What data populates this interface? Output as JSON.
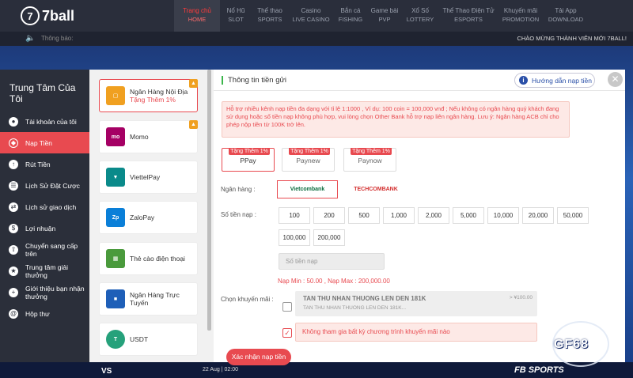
{
  "nav": {
    "logo_text": "7ball",
    "items": [
      {
        "label": "Trang chủ",
        "sub": "HOME",
        "active": true
      },
      {
        "label": "Nổ Hũ",
        "sub": "SLOT"
      },
      {
        "label": "Thể thao",
        "sub": "SPORTS"
      },
      {
        "label": "Casino",
        "sub": "LIVE CASINO"
      },
      {
        "label": "Bắn cá",
        "sub": "FISHING"
      },
      {
        "label": "Game bài",
        "sub": "PVP"
      },
      {
        "label": "Xổ Số",
        "sub": "LOTTERY"
      },
      {
        "label": "Thể Thao Điện Tử",
        "sub": "ESPORTS"
      },
      {
        "label": "Khuyến mãi",
        "sub": "PROMOTION"
      },
      {
        "label": "Tải App",
        "sub": "DOWNLOAD"
      }
    ]
  },
  "notice": {
    "label": "Thông báo:",
    "welcome": "CHÀO MỪNG THÀNH VIÊN MỚI 7BALL!"
  },
  "sidebar": {
    "title": "Trung Tâm Của Tôi",
    "items": [
      {
        "label": "Tài khoản của tôi"
      },
      {
        "label": "Nạp Tiền",
        "active": true
      },
      {
        "label": "Rút Tiền"
      },
      {
        "label": "Lịch Sử Đặt Cược"
      },
      {
        "label": "Lịch sử giao dịch"
      },
      {
        "label": "Lợi nhuận"
      },
      {
        "label": "Chuyển sang cấp trên"
      },
      {
        "label": "Trung tâm giải thưởng"
      },
      {
        "label": "Giới thiệu bạn nhận thưởng"
      },
      {
        "label": "Hộp thư"
      }
    ]
  },
  "methods": [
    {
      "name": "Ngân Hàng Nội Địa",
      "extra": "Tặng Thêm 1%",
      "active": true,
      "tag": true
    },
    {
      "name": "Momo",
      "tag": true
    },
    {
      "name": "ViettelPay"
    },
    {
      "name": "ZaloPay"
    },
    {
      "name": "Thẻ cào điện thoại"
    },
    {
      "name": "Ngân Hàng Trực Tuyến"
    },
    {
      "name": "USDT"
    }
  ],
  "panel": {
    "title": "Thông tin tiền gửi",
    "guide_label": "Hướng dẫn nạp tiền",
    "close_label": "✕",
    "info_text": "Hỗ trợ nhiều kênh nạp tiền đa dạng với tỉ lệ 1:1000 , Ví dụ: 100 coin = 100,000 vnđ ; Nếu không có ngân hàng quý khách đang sử dụng hoặc số tiền nạp không phù hợp, vui lòng chọn Other Bank hỗ trợ nạp liên ngân hàng. Lưu ý: Ngân hàng ACB chỉ cho phép nộp tiền từ 100K trở lên.",
    "gateways": [
      {
        "tag": "Tặng Thêm 1%",
        "name": "PPay",
        "active": true
      },
      {
        "tag": "Tặng Thêm 1%",
        "name": "Paynew"
      },
      {
        "tag": "Tặng Thêm 1%",
        "name": "Paynow"
      }
    ],
    "bank_label": "Ngân hàng :",
    "banks": [
      "Vietcombank",
      "TECHCOMBANK"
    ],
    "amount_label": "Số tiền nạp :",
    "amounts": [
      "100",
      "200",
      "500",
      "1,000",
      "2,000",
      "5,000",
      "10,000",
      "20,000",
      "50,000",
      "100,000",
      "200,000"
    ],
    "amount_placeholder": "Số tiền nạp",
    "min_max": "Nạp Min : 50.00 ,  Nạp Max : 200,000.00",
    "promo_label": "Chọn khuyến mãi :",
    "promo_title": "TAN THU NHAN THUONG LEN DEN 181K",
    "promo_sub": "TAN THU NHAN THUONG LEN DEN 181K...",
    "promo_amount": "> ¥100.00",
    "promo_none": "Không tham gia bất kỳ chương trình khuyến mãi nào",
    "submit_label": "Xác nhận nạp tiền"
  },
  "footer": {
    "vs": "VS",
    "date": "22 Aug | 02:00",
    "brand": "FB SPORTS"
  },
  "watermark": "GF68"
}
